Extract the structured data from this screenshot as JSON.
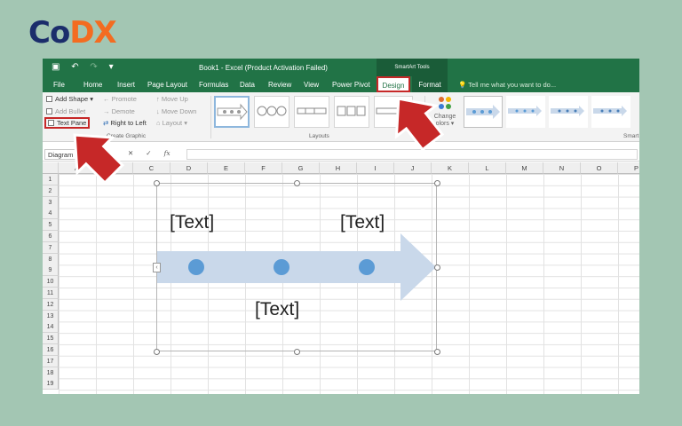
{
  "brand": {
    "logo_part1": "Co",
    "logo_part2": "DX"
  },
  "window": {
    "title": "Book1 - Excel (Product Activation Failed)",
    "context_tools": "SmartArt Tools"
  },
  "tabs": [
    "File",
    "Home",
    "Insert",
    "Page Layout",
    "Formulas",
    "Data",
    "Review",
    "View",
    "Power Pivot",
    "Design",
    "Format"
  ],
  "tell_me": "Tell me what you want to do...",
  "ribbon": {
    "create_graphic": {
      "add_shape": "Add Shape",
      "add_bullet": "Add Bullet",
      "text_pane": "Text Pane",
      "promote": "Promote",
      "demote": "Demote",
      "right_to_left": "Right to Left",
      "move_up": "Move Up",
      "move_down": "Move Down",
      "layout": "Layout",
      "group_label": "Create Graphic"
    },
    "layouts_label": "Layouts",
    "change_colors_1": "Change",
    "change_colors_2": "olors",
    "smartart_styles_label": "Smart"
  },
  "formula_bar": {
    "name_box": "Diagram 3",
    "cancel": "✕",
    "enter": "✓",
    "fx": "fx",
    "value": ""
  },
  "columns": [
    "A",
    "B",
    "C",
    "D",
    "E",
    "F",
    "G",
    "H",
    "I",
    "J",
    "K",
    "L",
    "M",
    "N",
    "O",
    "P"
  ],
  "rows": [
    "1",
    "2",
    "3",
    "4",
    "5",
    "6",
    "7",
    "8",
    "9",
    "10",
    "11",
    "12",
    "13",
    "14",
    "15",
    "16",
    "17",
    "18",
    "19"
  ],
  "smartart": {
    "text1": "[Text]",
    "text2": "[Text]",
    "text3": "[Text]"
  },
  "colors": {
    "excel_green": "#217346",
    "arrow_fill": "#c9d8ea",
    "node": "#5b9bd5",
    "highlight_red": "#c62828",
    "background": "#a3c6b3"
  }
}
